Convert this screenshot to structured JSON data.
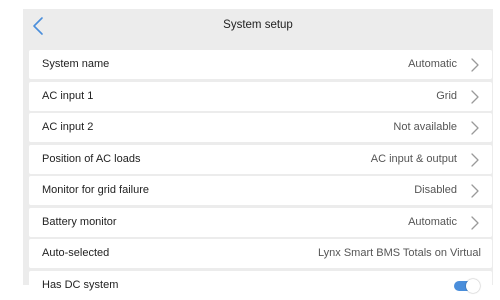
{
  "header": {
    "title": "System setup",
    "back_icon": "chevron-left-icon"
  },
  "colors": {
    "accent": "#4a8edb",
    "chevron": "#9a9a9a",
    "panel_background": "#ececec",
    "row_background": "#ffffff"
  },
  "rows": [
    {
      "label": "System name",
      "value": "Automatic",
      "chevron": true
    },
    {
      "label": "AC input 1",
      "value": "Grid",
      "chevron": true
    },
    {
      "label": "AC input 2",
      "value": "Not available",
      "chevron": true
    },
    {
      "label": "Position of AC loads",
      "value": "AC input & output",
      "chevron": true
    },
    {
      "label": "Monitor for grid failure",
      "value": "Disabled",
      "chevron": true
    },
    {
      "label": "Battery monitor",
      "value": "Automatic",
      "chevron": true
    },
    {
      "label": "Auto-selected",
      "value": "Lynx Smart BMS Totals on Virtual",
      "chevron": false
    },
    {
      "label": "Has DC system",
      "toggle_on": true
    }
  ]
}
